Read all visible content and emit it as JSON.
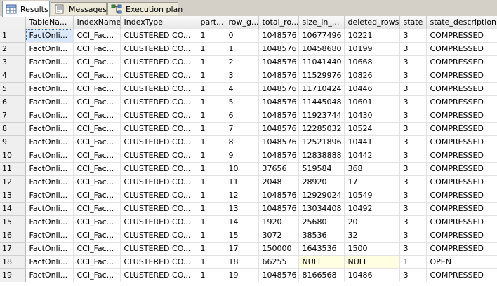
{
  "tabs": [
    {
      "label": "Results",
      "icon": "grid-icon",
      "active": true
    },
    {
      "label": "Messages",
      "icon": "messages-icon",
      "active": false
    },
    {
      "label": "Execution plan",
      "icon": "execution-plan-icon",
      "active": false
    }
  ],
  "columns": [
    "",
    "TableNa...",
    "IndexName",
    "IndexType",
    "part...",
    "row_g...",
    "total_ro...",
    "size_in_...",
    "deleted_rows",
    "state",
    "state_description"
  ],
  "rows": [
    [
      "1",
      "FactOnli...",
      "CCI_Fac...",
      "CLUSTERED CO...",
      "1",
      "0",
      "1048576",
      "10677496",
      "10221",
      "3",
      "COMPRESSED"
    ],
    [
      "2",
      "FactOnli...",
      "CCI_Fac...",
      "CLUSTERED CO...",
      "1",
      "1",
      "1048576",
      "10458680",
      "10199",
      "3",
      "COMPRESSED"
    ],
    [
      "3",
      "FactOnli...",
      "CCI_Fac...",
      "CLUSTERED CO...",
      "1",
      "2",
      "1048576",
      "11041440",
      "10668",
      "3",
      "COMPRESSED"
    ],
    [
      "4",
      "FactOnli...",
      "CCI_Fac...",
      "CLUSTERED CO...",
      "1",
      "3",
      "1048576",
      "11529976",
      "10826",
      "3",
      "COMPRESSED"
    ],
    [
      "5",
      "FactOnli...",
      "CCI_Fac...",
      "CLUSTERED CO...",
      "1",
      "4",
      "1048576",
      "11710424",
      "10446",
      "3",
      "COMPRESSED"
    ],
    [
      "6",
      "FactOnli...",
      "CCI_Fac...",
      "CLUSTERED CO...",
      "1",
      "5",
      "1048576",
      "11445048",
      "10601",
      "3",
      "COMPRESSED"
    ],
    [
      "7",
      "FactOnli...",
      "CCI_Fac...",
      "CLUSTERED CO...",
      "1",
      "6",
      "1048576",
      "11923744",
      "10430",
      "3",
      "COMPRESSED"
    ],
    [
      "8",
      "FactOnli...",
      "CCI_Fac...",
      "CLUSTERED CO...",
      "1",
      "7",
      "1048576",
      "12285032",
      "10524",
      "3",
      "COMPRESSED"
    ],
    [
      "9",
      "FactOnli...",
      "CCI_Fac...",
      "CLUSTERED CO...",
      "1",
      "8",
      "1048576",
      "12521896",
      "10441",
      "3",
      "COMPRESSED"
    ],
    [
      "10",
      "FactOnli...",
      "CCI_Fac...",
      "CLUSTERED CO...",
      "1",
      "9",
      "1048576",
      "12838888",
      "10442",
      "3",
      "COMPRESSED"
    ],
    [
      "11",
      "FactOnli...",
      "CCI_Fac...",
      "CLUSTERED CO...",
      "1",
      "10",
      "37656",
      "519584",
      "368",
      "3",
      "COMPRESSED"
    ],
    [
      "12",
      "FactOnli...",
      "CCI_Fac...",
      "CLUSTERED CO...",
      "1",
      "11",
      "2048",
      "28920",
      "17",
      "3",
      "COMPRESSED"
    ],
    [
      "13",
      "FactOnli...",
      "CCI_Fac...",
      "CLUSTERED CO...",
      "1",
      "12",
      "1048576",
      "12929024",
      "10549",
      "3",
      "COMPRESSED"
    ],
    [
      "14",
      "FactOnli...",
      "CCI_Fac...",
      "CLUSTERED CO...",
      "1",
      "13",
      "1048576",
      "13034408",
      "10492",
      "3",
      "COMPRESSED"
    ],
    [
      "15",
      "FactOnli...",
      "CCI_Fac...",
      "CLUSTERED CO...",
      "1",
      "14",
      "1920",
      "25680",
      "20",
      "3",
      "COMPRESSED"
    ],
    [
      "16",
      "FactOnli...",
      "CCI_Fac...",
      "CLUSTERED CO...",
      "1",
      "15",
      "3072",
      "38536",
      "32",
      "3",
      "COMPRESSED"
    ],
    [
      "17",
      "FactOnli...",
      "CCI_Fac...",
      "CLUSTERED CO...",
      "1",
      "17",
      "150000",
      "1643536",
      "1500",
      "3",
      "COMPRESSED"
    ],
    [
      "18",
      "FactOnli...",
      "CCI_Fac...",
      "CLUSTERED CO...",
      "1",
      "18",
      "66255",
      "NULL",
      "NULL",
      "1",
      "OPEN"
    ],
    [
      "19",
      "FactOnli...",
      "CCI_Fac...",
      "CLUSTERED CO...",
      "1",
      "19",
      "1048576",
      "8166568",
      "10486",
      "3",
      "COMPRESSED"
    ]
  ],
  "selected_cell": {
    "row": 0,
    "col": 1
  },
  "colors": {
    "null_bg": "#ffffe1",
    "selection_bg": "#d9e8fb"
  }
}
